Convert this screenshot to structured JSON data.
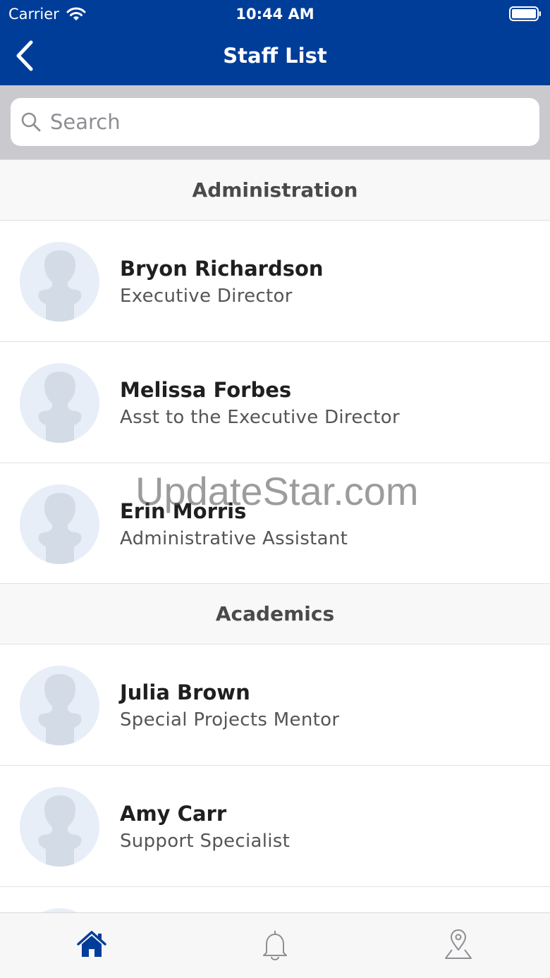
{
  "status_bar": {
    "carrier": "Carrier",
    "time": "10:44 AM"
  },
  "nav": {
    "title": "Staff List"
  },
  "search": {
    "placeholder": "Search",
    "value": ""
  },
  "sections": [
    {
      "title": "Administration",
      "staff": [
        {
          "name": "Bryon Richardson",
          "title": "Executive Director"
        },
        {
          "name": "Melissa Forbes",
          "title": "Asst to the Executive Director"
        },
        {
          "name": "Erin Morris",
          "title": "Administrative Assistant"
        }
      ]
    },
    {
      "title": "Academics",
      "staff": [
        {
          "name": "Julia Brown",
          "title": "Special Projects Mentor"
        },
        {
          "name": "Amy Carr",
          "title": "Support Specialist"
        }
      ]
    }
  ],
  "watermark": "UpdateStar.com",
  "tab_bar": {
    "items": [
      {
        "icon": "home-icon",
        "active": true
      },
      {
        "icon": "bell-icon",
        "active": false
      },
      {
        "icon": "map-pin-icon",
        "active": false
      }
    ]
  },
  "colors": {
    "header": "#003d99",
    "active_tab": "#003d99",
    "inactive_tab": "#8e8e93",
    "avatar_bg": "#e7eef8"
  }
}
